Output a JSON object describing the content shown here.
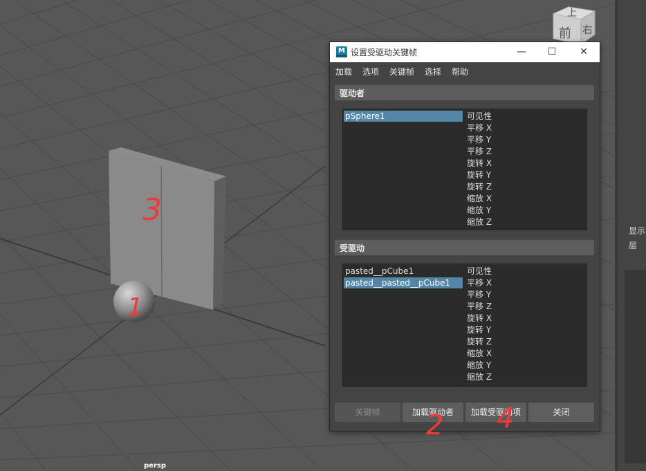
{
  "viewport": {
    "camera_label": "persp",
    "background_color": "#575757",
    "grid_color": "#4a4a4a",
    "viewcube": {
      "top_face": "上",
      "front_face": "前",
      "right_face": "右"
    }
  },
  "right_panel": {
    "display_label": "显示",
    "layer_label": "层"
  },
  "dialog": {
    "app_icon": "maya-icon",
    "app_icon_letter": "M",
    "title": "设置受驱动关键帧",
    "window_controls": {
      "minimize": "—",
      "maximize": "☐",
      "close": "✕"
    },
    "menu": [
      "加载",
      "选项",
      "关键帧",
      "选择",
      "帮助"
    ],
    "driver": {
      "header": "驱动者",
      "objects": [
        {
          "name": "pSphere1",
          "selected": true
        }
      ],
      "attributes": [
        "可见性",
        "平移 X",
        "平移 Y",
        "平移 Z",
        "旋转 X",
        "旋转 Y",
        "旋转 Z",
        "缩放 X",
        "缩放 Y",
        "缩放 Z"
      ]
    },
    "driven": {
      "header": "受驱动",
      "objects": [
        {
          "name": "pasted__pCube1",
          "selected": false
        },
        {
          "name": "pasted__pasted__pCube1",
          "selected": true
        }
      ],
      "attributes": [
        "可见性",
        "平移 X",
        "平移 Y",
        "平移 Z",
        "旋转 X",
        "旋转 Y",
        "旋转 Z",
        "缩放 X",
        "缩放 Y",
        "缩放 Z"
      ]
    },
    "buttons": {
      "key": "关键帧",
      "load_driver": "加载驱动者",
      "load_driven": "加载受驱动项",
      "close": "关闭"
    },
    "selection_color": "#5285a6"
  },
  "annotations": [
    "1",
    "2",
    "3",
    "4"
  ],
  "annotation_color": "#f03a3a"
}
